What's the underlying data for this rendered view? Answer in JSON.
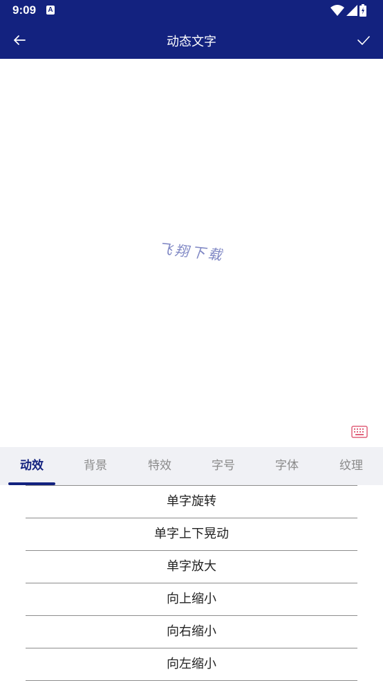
{
  "status": {
    "time": "9:09",
    "notification_letter": "A"
  },
  "appbar": {
    "title": "动态文字"
  },
  "preview": {
    "text": "飞翔下载",
    "color": "#7f87c4"
  },
  "tabs": [
    {
      "label": "动效",
      "active": true
    },
    {
      "label": "背景",
      "active": false
    },
    {
      "label": "特效",
      "active": false
    },
    {
      "label": "字号",
      "active": false
    },
    {
      "label": "字体",
      "active": false
    },
    {
      "label": "纹理",
      "active": false
    }
  ],
  "effects": [
    {
      "label": "单字旋转"
    },
    {
      "label": "单字上下晃动"
    },
    {
      "label": "单字放大"
    },
    {
      "label": "向上缩小"
    },
    {
      "label": "向右缩小"
    },
    {
      "label": "向左缩小"
    }
  ],
  "colors": {
    "primary": "#13227f",
    "tab_bg": "#f0f1f5",
    "keyboard_icon": "#e0607a"
  }
}
